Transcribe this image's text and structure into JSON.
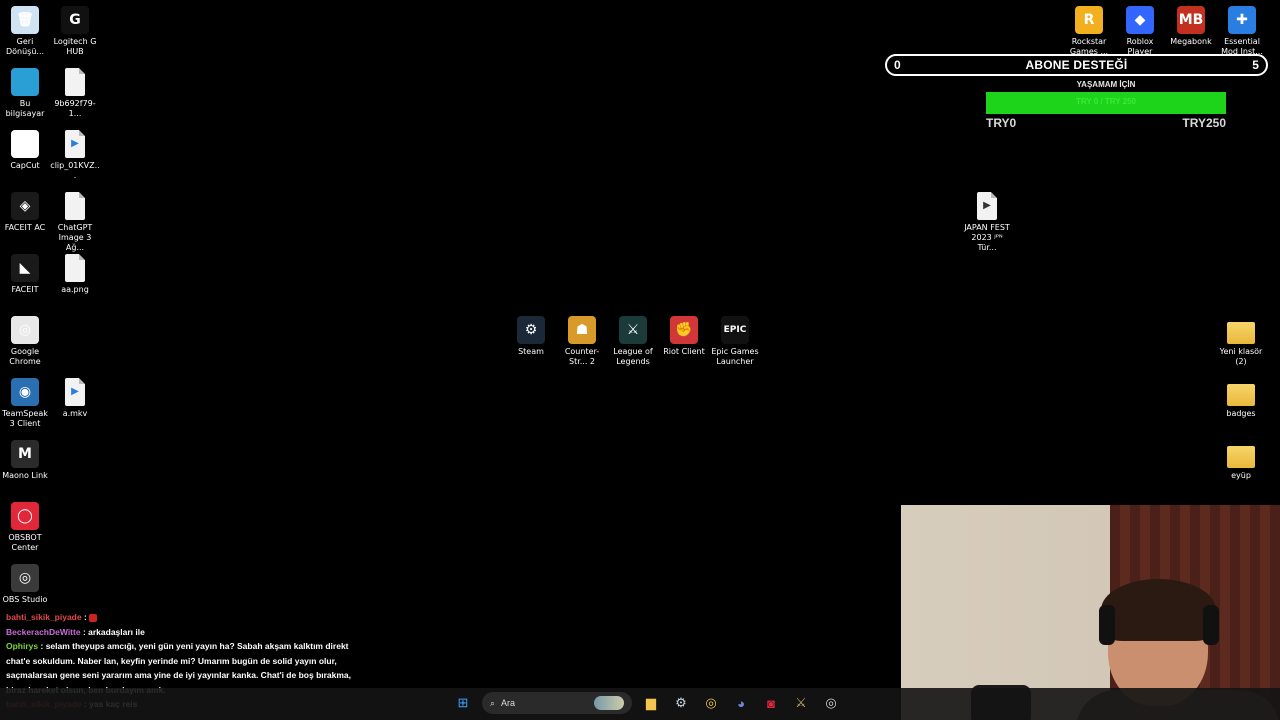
{
  "desktop": {
    "left_col1": [
      {
        "label": "Geri Dönüşü...",
        "icon": "recycle-bin-icon",
        "bg": "#cfe3f2",
        "glyph": "🗑"
      },
      {
        "label": "Bu bilgisayar",
        "icon": "computer-icon",
        "bg": "#2a9fd6",
        "glyph": ""
      },
      {
        "label": "CapCut",
        "icon": "capcut-icon",
        "bg": "#ffffff",
        "glyph": "✂"
      },
      {
        "label": "FACEIT AC",
        "icon": "faceit-ac-icon",
        "bg": "#1a1a1a",
        "glyph": "◈"
      },
      {
        "label": "FACEIT",
        "icon": "faceit-icon",
        "bg": "#1a1a1a",
        "glyph": "◣"
      },
      {
        "label": "Google Chrome",
        "icon": "chrome-icon",
        "bg": "#e8e8e8",
        "glyph": "◎"
      },
      {
        "label": "TeamSpeak 3 Client",
        "icon": "teamspeak-icon",
        "bg": "#2b6fb3",
        "glyph": "◉"
      },
      {
        "label": "Maono Link",
        "icon": "maono-icon",
        "bg": "#2b2b2b",
        "glyph": "M"
      },
      {
        "label": "OBSBOT Center",
        "icon": "obsbot-icon",
        "bg": "#e0283a",
        "glyph": "◯"
      },
      {
        "label": "OBS Studio",
        "icon": "obs-icon",
        "bg": "#3a3a3a",
        "glyph": "◎"
      }
    ],
    "left_col2": [
      {
        "label": "Logitech G HUB",
        "icon": "logitech-icon",
        "bg": "#111111",
        "glyph": "G"
      },
      {
        "label": "9b692f79-1...",
        "icon": "image-file-icon",
        "bg": "file",
        "glyph": ""
      },
      {
        "label": "clip_01KVZ...",
        "icon": "video-file-icon",
        "bg": "file",
        "glyph": "▶"
      },
      {
        "label": "ChatGPT Image 3 Ağ...",
        "icon": "image-file-icon",
        "bg": "file",
        "glyph": ""
      },
      {
        "label": "aa.png",
        "icon": "image-file-icon",
        "bg": "file",
        "glyph": ""
      },
      {
        "label": "a.mkv",
        "icon": "video-file-icon",
        "bg": "file",
        "glyph": "▶"
      }
    ],
    "center": [
      {
        "label": "Steam",
        "icon": "steam-icon",
        "bg": "#1b2838",
        "glyph": "⚙"
      },
      {
        "label": "Counter-Str... 2",
        "icon": "cs2-icon",
        "bg": "#d89b2a",
        "glyph": "☗"
      },
      {
        "label": "League of Legends",
        "icon": "lol-icon",
        "bg": "#1b3a3a",
        "glyph": "⚔"
      },
      {
        "label": "Riot Client",
        "icon": "riot-icon",
        "bg": "#d13639",
        "glyph": "✊"
      },
      {
        "label": "Epic Games Launcher",
        "icon": "epic-icon",
        "bg": "#111111",
        "glyph": "EPIC"
      }
    ],
    "top_right": [
      {
        "label": "Rockstar Games ...",
        "icon": "rockstar-icon",
        "bg": "#f2b01e",
        "glyph": "R"
      },
      {
        "label": "Roblox Player",
        "icon": "roblox-icon",
        "bg": "#3366ff",
        "glyph": "◆"
      },
      {
        "label": "Megabonk",
        "icon": "megabonk-icon",
        "bg": "#c33020",
        "glyph": "MB"
      },
      {
        "label": "Essential Mod Inst...",
        "icon": "essential-icon",
        "bg": "#2a7de1",
        "glyph": "✚"
      }
    ],
    "japan": {
      "label": "JAPAN FEST 2023 ᴶᴾᴺ Tür...",
      "icon": "video-file-icon"
    },
    "right_col": [
      {
        "label": "Yeni klasör (2)",
        "icon": "folder-icon"
      },
      {
        "label": "badges",
        "icon": "folder-icon"
      },
      {
        "label": "eyüp",
        "icon": "folder-icon"
      }
    ]
  },
  "goal": {
    "min": "0",
    "title": "ABONE DESTEĞİ",
    "max": "5",
    "progress": 0
  },
  "donation": {
    "caption": "YAŞAMAM İÇİN",
    "bar_text": "TRY 0 / TRY 250",
    "start": "TRY0",
    "end": "TRY250",
    "progress": 1.0,
    "fill_color": "#1ed41a"
  },
  "chat": [
    {
      "user": "bahti_sikik_piyade",
      "text": "",
      "badge": true,
      "user_color": "red"
    },
    {
      "user": "BeckerachDeWitte",
      "text": "arkadaşları ile",
      "badge": false,
      "user_color": "pink"
    },
    {
      "user": "Ophirys",
      "text": "selam theyups amcığı, yeni gün yeni yayın ha? Sabah akşam kalktım direkt chat'e sokuldum. Naber lan, keyfin yerinde mi? Umarım bugün de solid yayın olur, saçmalarsan gene seni yararım ama yine de iyi yayınlar kanka. Chat'i de boş bırakma, biraz hareket olsun, ben burdayım amk.",
      "badge": false,
      "user_color": "green"
    },
    {
      "user": "bahti_sikik_piyade",
      "text": "yas kaç reis",
      "badge": false,
      "user_color": "red"
    }
  ],
  "taskbar": {
    "search_placeholder": "Ara",
    "apps": [
      {
        "name": "windows-start-icon",
        "glyph": "⊞",
        "color": "#3aa0ff"
      },
      {
        "name": "file-explorer-icon",
        "glyph": "▆",
        "color": "#f4c44e"
      },
      {
        "name": "steam-taskbar-icon",
        "glyph": "⚙",
        "color": "#c7d5e0"
      },
      {
        "name": "chrome-taskbar-icon",
        "glyph": "◎",
        "color": "#e8c547"
      },
      {
        "name": "discord-taskbar-icon",
        "glyph": "◕",
        "color": "#7289da"
      },
      {
        "name": "obsbot-taskbar-icon",
        "glyph": "◙",
        "color": "#e0283a"
      },
      {
        "name": "league-taskbar-icon",
        "glyph": "⚔",
        "color": "#c8aa6e"
      },
      {
        "name": "obs-taskbar-icon",
        "glyph": "◎",
        "color": "#d0d0d0"
      }
    ]
  }
}
